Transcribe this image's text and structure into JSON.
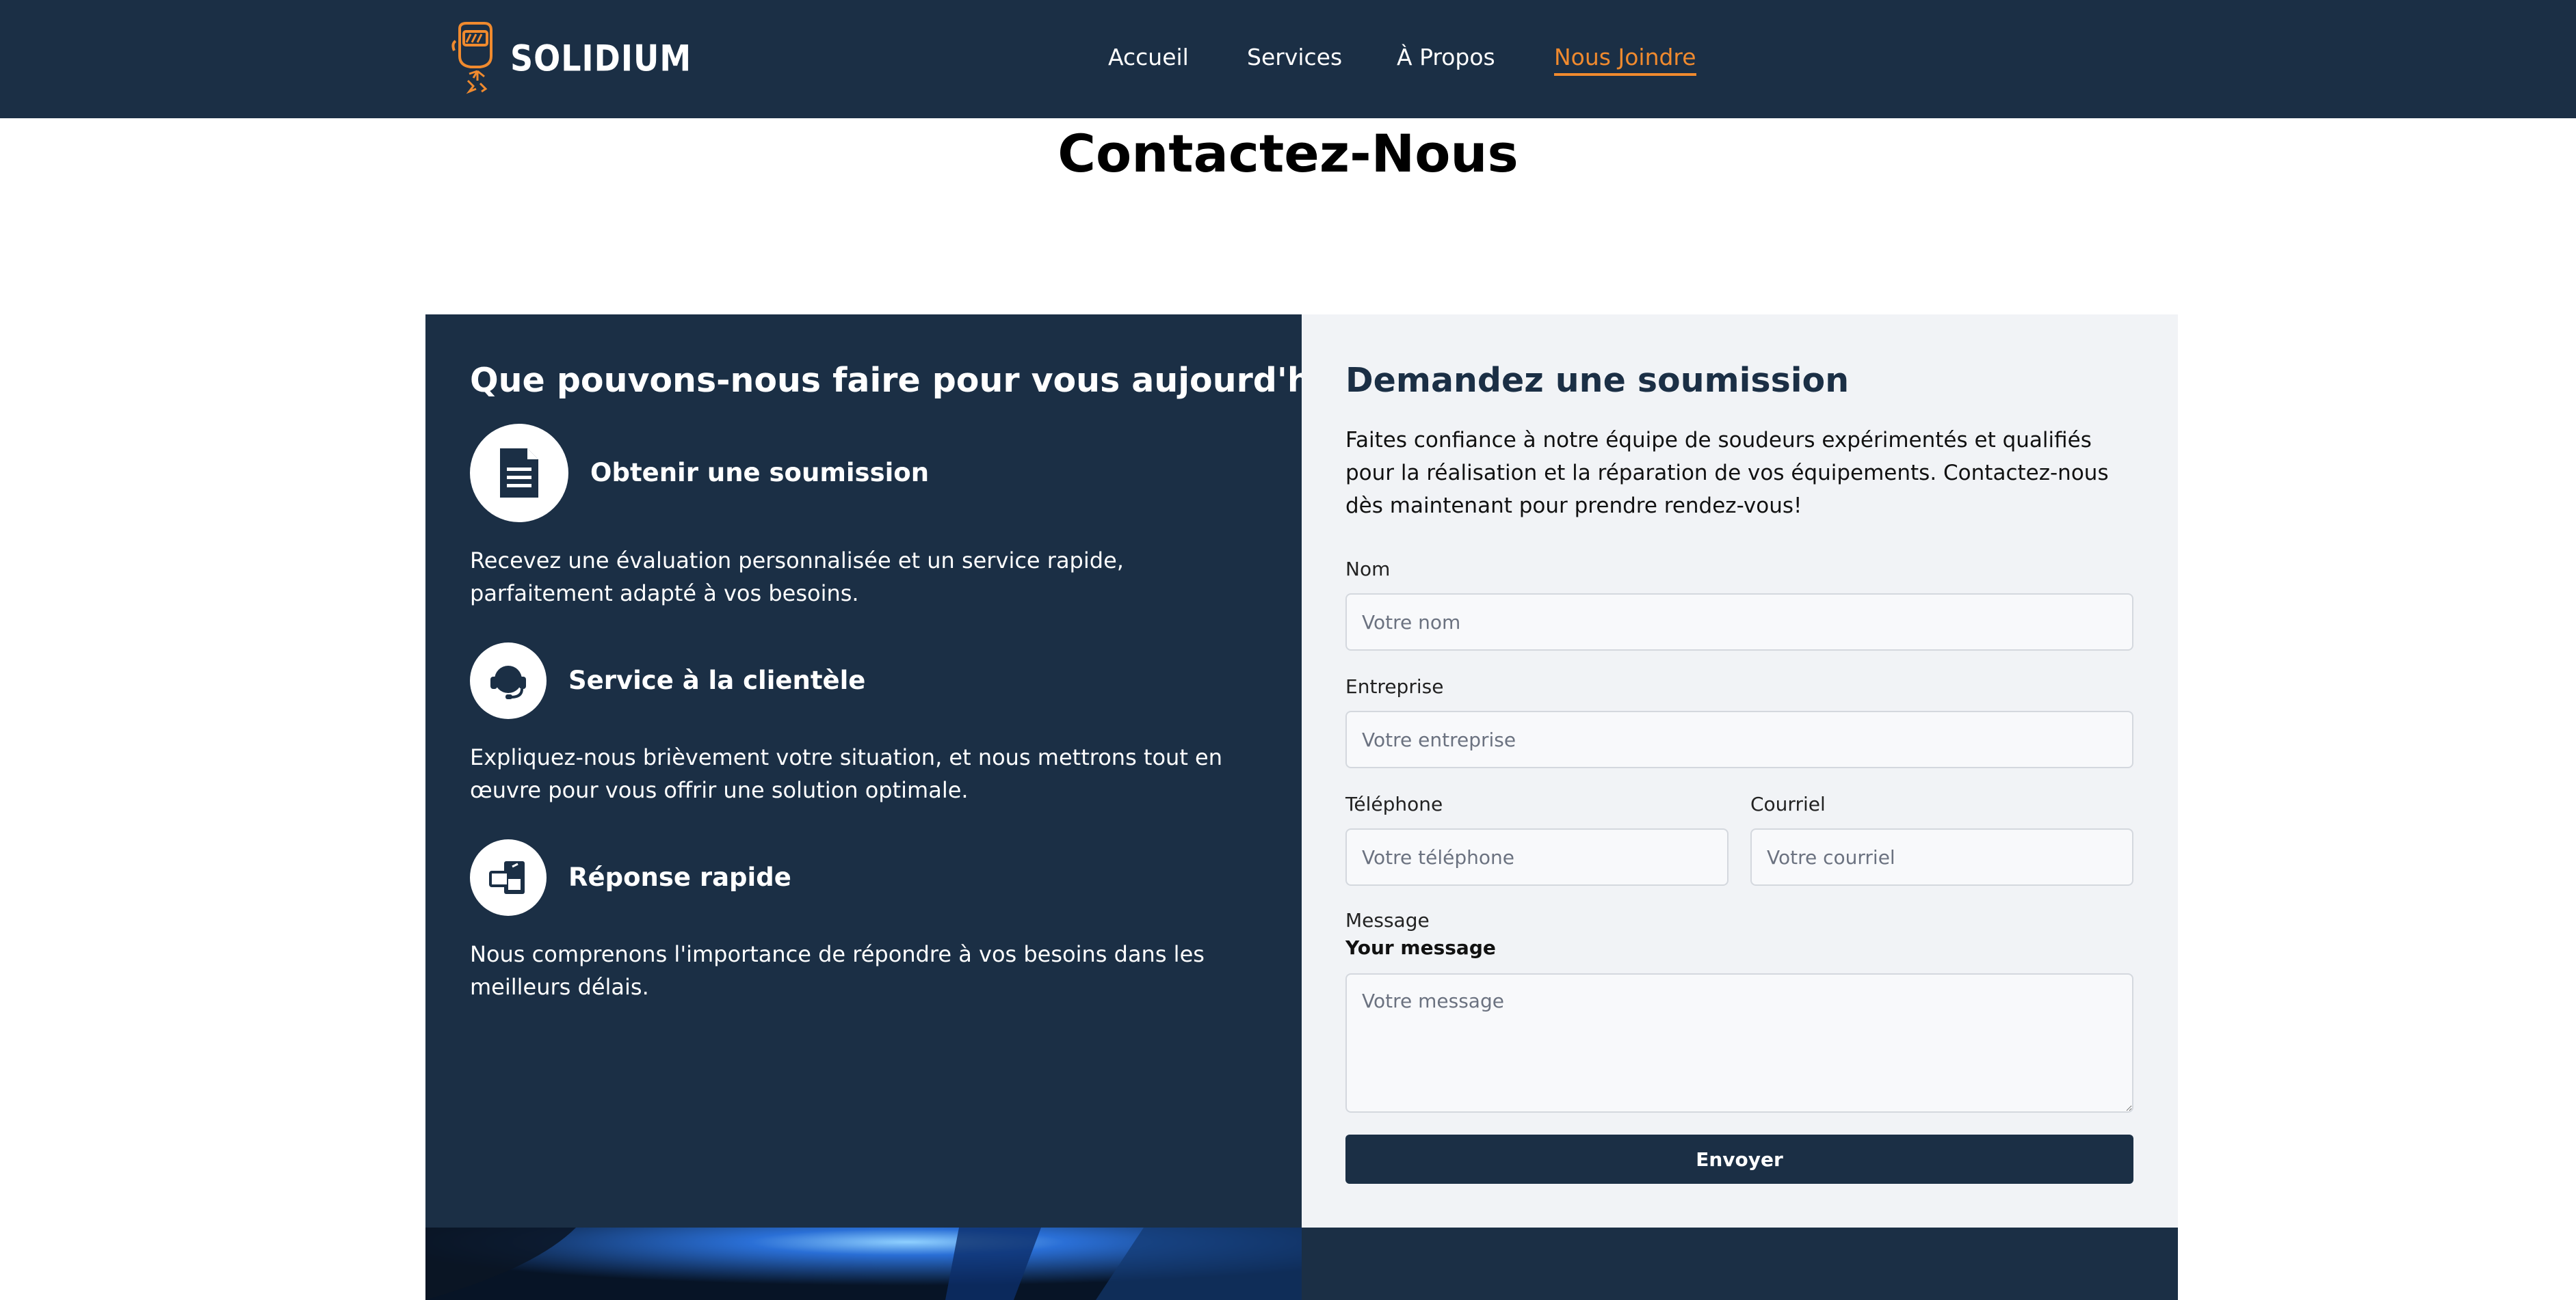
{
  "brand": {
    "name": "SOLIDIUM",
    "accent": "#f08a2e",
    "navy": "#1b2f45"
  },
  "nav": {
    "items": [
      {
        "label": "Accueil"
      },
      {
        "label": "Services"
      },
      {
        "label": "À Propos"
      },
      {
        "label": "Nous Joindre",
        "active": true
      }
    ]
  },
  "page": {
    "title": "Contactez-Nous"
  },
  "left": {
    "heading": "Que pouvons-nous faire pour vous aujourd'hui?",
    "features": [
      {
        "icon": "document-icon",
        "title": "Obtenir une soumission",
        "desc": "Recevez une évaluation personnalisée et un service rapide, parfaitement adapté à vos besoins."
      },
      {
        "icon": "headset-icon",
        "title": "Service à la clientèle",
        "desc": "Expliquez-nous brièvement votre situation, et nous mettrons tout en œuvre pour vous offrir une solution optimale."
      },
      {
        "icon": "devices-icon",
        "title": "Réponse rapide",
        "desc": "Nous comprenons l'importance de répondre à vos besoins dans les meilleurs délais."
      }
    ]
  },
  "form": {
    "heading": "Demandez une soumission",
    "intro": "Faites confiance à notre équipe de soudeurs expérimentés et qualifiés pour la réalisation et la réparation de vos équipements. Contactez-nous dès maintenant pour prendre rendez-vous!",
    "name": {
      "label": "Nom",
      "placeholder": "Votre nom",
      "value": ""
    },
    "company": {
      "label": "Entreprise",
      "placeholder": "Votre entreprise",
      "value": ""
    },
    "phone": {
      "label": "Téléphone",
      "placeholder": "Votre téléphone",
      "value": ""
    },
    "email": {
      "label": "Courriel",
      "placeholder": "Votre courriel",
      "value": ""
    },
    "message": {
      "label": "Message",
      "sublabel": "Your message",
      "placeholder": "Votre message",
      "value": ""
    },
    "submit_label": "Envoyer"
  }
}
